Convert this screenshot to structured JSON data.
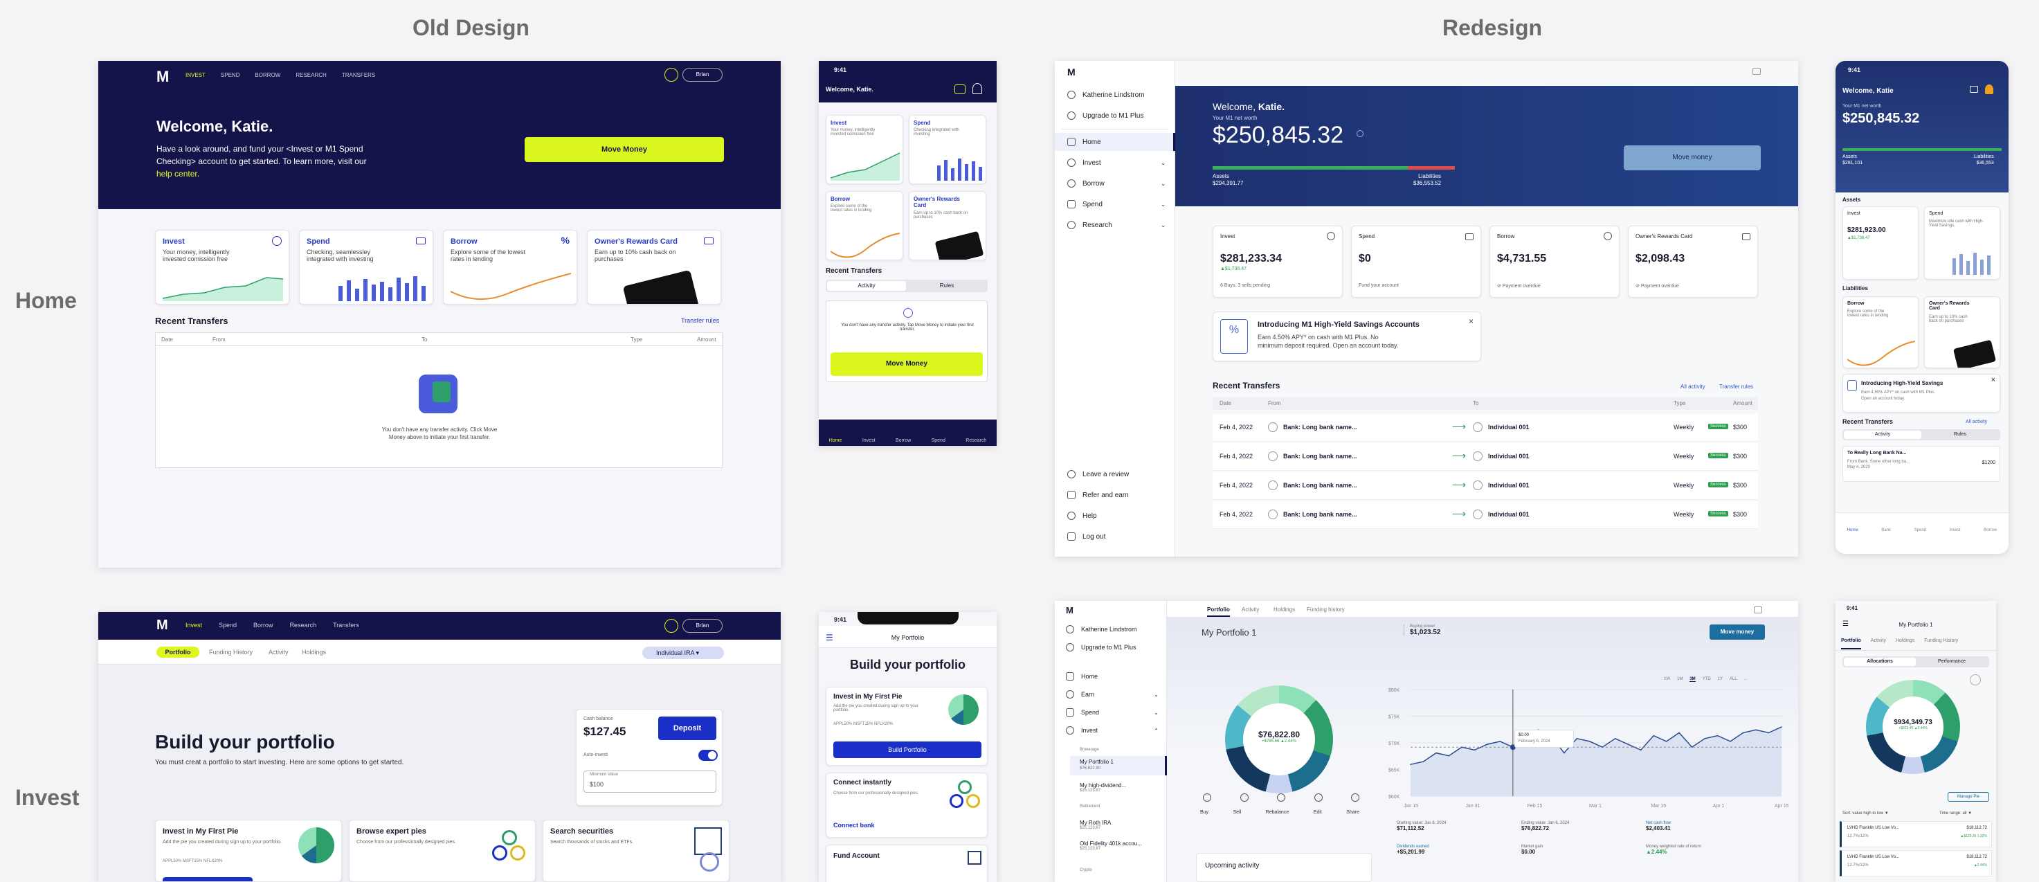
{
  "headers": {
    "old": "Old Design",
    "new": "Redesign",
    "home": "Home",
    "invest": "Invest"
  },
  "old_home_desktop": {
    "nav": [
      "INVEST",
      "SPEND",
      "BORROW",
      "RESEARCH",
      "TRANSFERS"
    ],
    "user": "Brian",
    "welcome": "Welcome, Katie.",
    "intro_lines": [
      "Have a look around, and fund your <Invest or M1 Spend",
      "Checking> account to get started. To learn more, visit our"
    ],
    "help_link": "help center.",
    "move_money": "Move Money",
    "cards": [
      {
        "title": "Invest",
        "desc": "Your money, intelligently invested comission free"
      },
      {
        "title": "Spend",
        "desc": "Checking, seamlessley integrated with investing"
      },
      {
        "title": "Borrow",
        "desc": "Explore some of the lowest rates in lending"
      },
      {
        "title": "Owner's Rewards Card",
        "desc": "Earn up to 10% cash back on purchases"
      }
    ],
    "recent": "Recent Transfers",
    "transfer_rules": "Transfer rules",
    "cols": [
      "Date",
      "From",
      "To",
      "Type",
      "Amount"
    ],
    "empty_lines": [
      "You don't have any transfer activity. Click Move",
      "Money above to initiate your first transfer."
    ]
  },
  "old_home_mobile": {
    "time": "9:41",
    "welcome": "Welcome, Katie.",
    "cards": [
      {
        "title": "Invest",
        "desc": "Your money, intelligently invested comission free"
      },
      {
        "title": "Spend",
        "desc": "Checking integrated with investing"
      },
      {
        "title": "Borrow",
        "desc": "Explore some of the lowest rates in lending"
      },
      {
        "title": "Owner's Rewards Card",
        "desc": "Earn up to 10% cash back on purchases"
      }
    ],
    "recent": "Recent Transfers",
    "tabs": [
      "Activity",
      "Rules"
    ],
    "empty": "You don't have any transfer activity. Tap Move Money to initiate your first transfer.",
    "move_money": "Move Money",
    "tabbar": [
      "Home",
      "Invest",
      "Borrow",
      "Spend",
      "Research"
    ]
  },
  "new_home_desktop": {
    "user": "Katherine Lindstrom",
    "upgrade": "Upgrade to M1 Plus",
    "nav": [
      "Home",
      "Invest",
      "Borrow",
      "Spend",
      "Research"
    ],
    "bottom_nav": [
      "Leave a review",
      "Refer and earn",
      "Help",
      "Log out"
    ],
    "welcome_prefix": "Welcome, ",
    "welcome_name": "Katie.",
    "networth_label": "Your M1 net worth",
    "networth": "$250,845.32",
    "assets_label": "Assets",
    "assets": "$294,391.77",
    "liabilities_label": "Liabilities",
    "liabilities": "$36,553.52",
    "move_money": "Move money",
    "cards": [
      {
        "title": "Invest",
        "value": "$281,233.34",
        "delta": "▲$1,736.47",
        "sub": "6 Buys, 3 sells pending"
      },
      {
        "title": "Spend",
        "value": "$0",
        "delta": "",
        "sub": "Fund your account"
      },
      {
        "title": "Borrow",
        "value": "$4,731.55",
        "delta": "",
        "sub": "Payment overdue"
      },
      {
        "title": "Owner's Rewards Card",
        "value": "$2,098.43",
        "delta": "",
        "sub": "Payment overdue"
      }
    ],
    "promo_title": "Introducing M1 High-Yield Savings Accounts",
    "promo_lines": [
      "Earn 4.50% APY* on cash with M1 Plus. No",
      "minimum deposit required. Open an account today."
    ],
    "recent": "Recent Transfers",
    "all_activity": "All activity",
    "transfer_rules": "Transfer rules",
    "cols": [
      "Date",
      "From",
      "To",
      "Type",
      "Amount"
    ],
    "rows": [
      {
        "date": "Feb 4, 2022",
        "from": "Bank: Long bank name...",
        "to": "Individual 001",
        "type": "Weekly",
        "status": "Success",
        "amount": "$300"
      },
      {
        "date": "Feb 4, 2022",
        "from": "Bank: Long bank name...",
        "to": "Individual 001",
        "type": "Weekly",
        "status": "Success",
        "amount": "$300"
      },
      {
        "date": "Feb 4, 2022",
        "from": "Bank: Long bank name...",
        "to": "Individual 001",
        "type": "Weekly",
        "status": "Success",
        "amount": "$300"
      },
      {
        "date": "Feb 4, 2022",
        "from": "Bank: Long bank name...",
        "to": "Individual 001",
        "type": "Weekly",
        "status": "Success",
        "amount": "$300"
      }
    ]
  },
  "new_home_mobile": {
    "time": "9:41",
    "welcome": "Welcome, Katie",
    "networth_label": "Your M1 net worth",
    "networth": "$250,845.32",
    "assets_label": "Assets",
    "assets": "$281,101",
    "liabilities_label": "Liabilities",
    "liabilities": "$36,553",
    "assets_section": "Assets",
    "invest_title": "Invest",
    "invest_value": "$281,923.00",
    "invest_delta": "▲$1,736.47",
    "spend_title": "Spend",
    "spend_desc": "Maximize idle cash with High-Yield Savings.",
    "liabilities_section": "Liabilities",
    "borrow_title": "Borrow",
    "borrow_desc": "Explore some of the lowest rates in lending",
    "card_title": "Owner's Rewards Card",
    "card_desc": "Earn up to 10% cash back on purchases",
    "promo_title": "Introducing High-Yield Savings",
    "promo_lines": [
      "Earn 4.50% APY* on cash with M1 Plus.",
      "Open an account today."
    ],
    "recent": "Recent Transfers",
    "all_activity": "All activity",
    "tabs": [
      "Activity",
      "Rules"
    ],
    "row_title": "To Really Long Bank Na...",
    "row_sub1": "From Bank, Some other long ba...",
    "row_sub2": "May 4, 2020",
    "row_amount": "$1200",
    "tabbar": [
      "Home",
      "Bank",
      "Spend",
      "Invest",
      "Borrow"
    ]
  },
  "old_invest_desktop": {
    "nav": [
      "Invest",
      "Spend",
      "Borrow",
      "Research",
      "Transfers"
    ],
    "user": "Brian",
    "tabs": [
      "Portfolio",
      "Funding History",
      "Activity",
      "Holdings"
    ],
    "account": "Individual IRA",
    "title": "Build your portfolio",
    "subtitle": "You must creat a portfolio to start investing. Here are some options to get started.",
    "cash_label": "Cash balance",
    "cash": "$127.45",
    "deposit": "Deposit",
    "autoinvest": "Auto-invest",
    "min_label": "Minimum Value",
    "min_value": "$100",
    "cards": [
      {
        "title": "Invest in My First Pie",
        "desc": "Add the pie you created during sign up to your portfolio.",
        "tickers": "APPL50%  MSFT15%  NFLX20%"
      },
      {
        "title": "Browse expert pies",
        "desc": "Choose from our professionally designed pies.",
        "tickers": ""
      },
      {
        "title": "Search securities",
        "desc": "Search thousands of stocks and ETFs.",
        "tickers": ""
      }
    ]
  },
  "old_invest_mobile": {
    "time": "9:41",
    "header": "My Portfolio",
    "title": "Build your portfolio",
    "card1_title": "Invest in My First Pie",
    "card1_desc": "Add the pie you created during sign up to your portfolio.",
    "card1_tickers": "APPL50%  MSFT15%  NFLX20%",
    "card1_btn": "Build Portfolio",
    "card2_title": "Connect instantly",
    "card2_desc": "Choose from our professionally designed pies.",
    "card2_link": "Connect bank",
    "card3_title": "Fund Account"
  },
  "new_invest_desktop": {
    "user": "Katherine Lindstrom",
    "upgrade": "Upgrade to M1 Plus",
    "nav": [
      "Home",
      "Earn",
      "Spend",
      "Invest"
    ],
    "sub_brokerage": "Brokerage",
    "portfolios": [
      {
        "name": "My Portfolio 1",
        "value": "$76,822.80"
      },
      {
        "name": "My high-dividend...",
        "value": "$25,123.87"
      }
    ],
    "sub_retirement": "Retirement",
    "retire": [
      {
        "name": "My Roth IRA",
        "value": "$25,123.87"
      },
      {
        "name": "Old Fidelity 401k accou...",
        "value": "$25,123.87"
      }
    ],
    "sub_crypto": "Crypto",
    "tabs": [
      "Portfolio",
      "Activity",
      "Holdings",
      "Funding history"
    ],
    "portfolio_title": "My Portfolio 1",
    "bp_label": "Buying power",
    "bp": "$1,023.52",
    "move_money": "Move money",
    "donut_value": "$76,822.80",
    "donut_delta": "+$795.66 ▲2.44%",
    "actions": [
      "Buy",
      "Sell",
      "Rebalance",
      "Edit",
      "Share"
    ],
    "ranges": [
      "1W",
      "1M",
      "3M",
      "YTD",
      "1Y",
      "ALL",
      "..."
    ],
    "tooltip_value": "$0.00",
    "tooltip_date": "February 6, 2024",
    "stats": [
      {
        "label": "Starting value: Jan 6, 2024",
        "value": "$71,112.52"
      },
      {
        "label": "Ending value: Jan 6, 2024",
        "value": "$76,822.72"
      },
      {
        "label": "Net cash flow",
        "value": "$2,403.41"
      },
      {
        "label": "Dividends earned",
        "value": "+$5,201.99"
      },
      {
        "label": "Market gain",
        "value": "$0.00"
      },
      {
        "label": "Money weighted rate of return",
        "value": "▲2.44%"
      }
    ],
    "upcoming": "Upcoming activity",
    "chart_data": {
      "type": "line",
      "x": [
        "Jan 15",
        "Jan 31",
        "Feb 15",
        "Mar 1",
        "Mar 15",
        "Apr 1",
        "Apr 15"
      ],
      "yticks": [
        "$90K",
        "$75K",
        "$70K",
        "$65K",
        "$60K"
      ],
      "values": [
        66,
        67,
        70,
        69,
        72,
        71,
        73,
        74,
        72,
        73,
        78,
        76,
        70,
        75,
        74,
        72,
        75,
        73,
        71,
        76,
        74,
        77,
        72,
        75,
        76,
        74,
        77,
        78,
        77,
        79
      ],
      "ylim": [
        55,
        92
      ]
    }
  },
  "new_invest_mobile": {
    "time": "9:41",
    "header": "My Portfolio 1",
    "tabs": [
      "Portfolio",
      "Activity",
      "Holdings",
      "Funding History"
    ],
    "seg": [
      "Allocations",
      "Performance"
    ],
    "donut_value": "$934,349.73",
    "donut_delta": "+$923.45 ▲2.44%",
    "manage": "Manage Pie",
    "sort": "Sort: value high to low ▼",
    "range": "Time range: all ▼",
    "holdings": [
      {
        "name": "LVHD  Franklin US Low Vo...",
        "pct": "12.7%/12%",
        "value": "$18,112.72",
        "delta": "▲$125.35  1.32%"
      },
      {
        "name": "LVHD  Franklin US Low Vo...",
        "pct": "12.7%/12%",
        "value": "$18,112.72",
        "delta": "▲2.44%"
      }
    ]
  }
}
